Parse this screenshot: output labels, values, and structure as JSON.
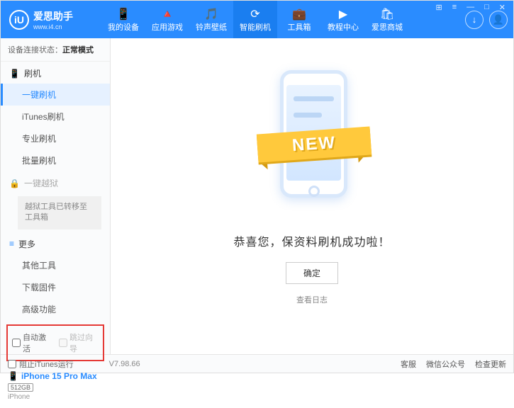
{
  "brand": {
    "name": "爱思助手",
    "url": "www.i4.cn",
    "logo_letter": "iU"
  },
  "topnav": [
    {
      "icon": "📱",
      "label": "我的设备"
    },
    {
      "icon": "🔺",
      "label": "应用游戏"
    },
    {
      "icon": "🎵",
      "label": "铃声壁纸"
    },
    {
      "icon": "⟳",
      "label": "智能刷机"
    },
    {
      "icon": "💼",
      "label": "工具箱"
    },
    {
      "icon": "▶",
      "label": "教程中心"
    },
    {
      "icon": "🛍",
      "label": "爱思商城"
    }
  ],
  "win_controls": {
    "grid": "⊞",
    "menu": "≡",
    "min": "—",
    "max": "□",
    "close": "✕"
  },
  "header_btns": {
    "download": "↓",
    "user": "👤"
  },
  "conn": {
    "label": "设备连接状态：",
    "value": "正常模式"
  },
  "sidebar": {
    "sec_flash": {
      "icon": "📱",
      "label": "刷机"
    },
    "items_flash": [
      "一键刷机",
      "iTunes刷机",
      "专业刷机",
      "批量刷机"
    ],
    "sec_jail": {
      "icon": "🔒",
      "label": "一键越狱"
    },
    "jail_note": "越狱工具已转移至工具箱",
    "sec_more": {
      "icon": "≡",
      "label": "更多"
    },
    "items_more": [
      "其他工具",
      "下载固件",
      "高级功能"
    ]
  },
  "checks": {
    "auto_activate": "自动激活",
    "skip_guide": "跳过向导"
  },
  "device": {
    "name": "iPhone 15 Pro Max",
    "storage": "512GB",
    "type": "iPhone"
  },
  "main": {
    "new_badge": "NEW",
    "success": "恭喜您，保资料刷机成功啦！",
    "ok": "确定",
    "view_log": "查看日志"
  },
  "footer": {
    "block_itunes": "阻止iTunes运行",
    "version": "V7.98.66",
    "links": [
      "客服",
      "微信公众号",
      "检查更新"
    ]
  }
}
